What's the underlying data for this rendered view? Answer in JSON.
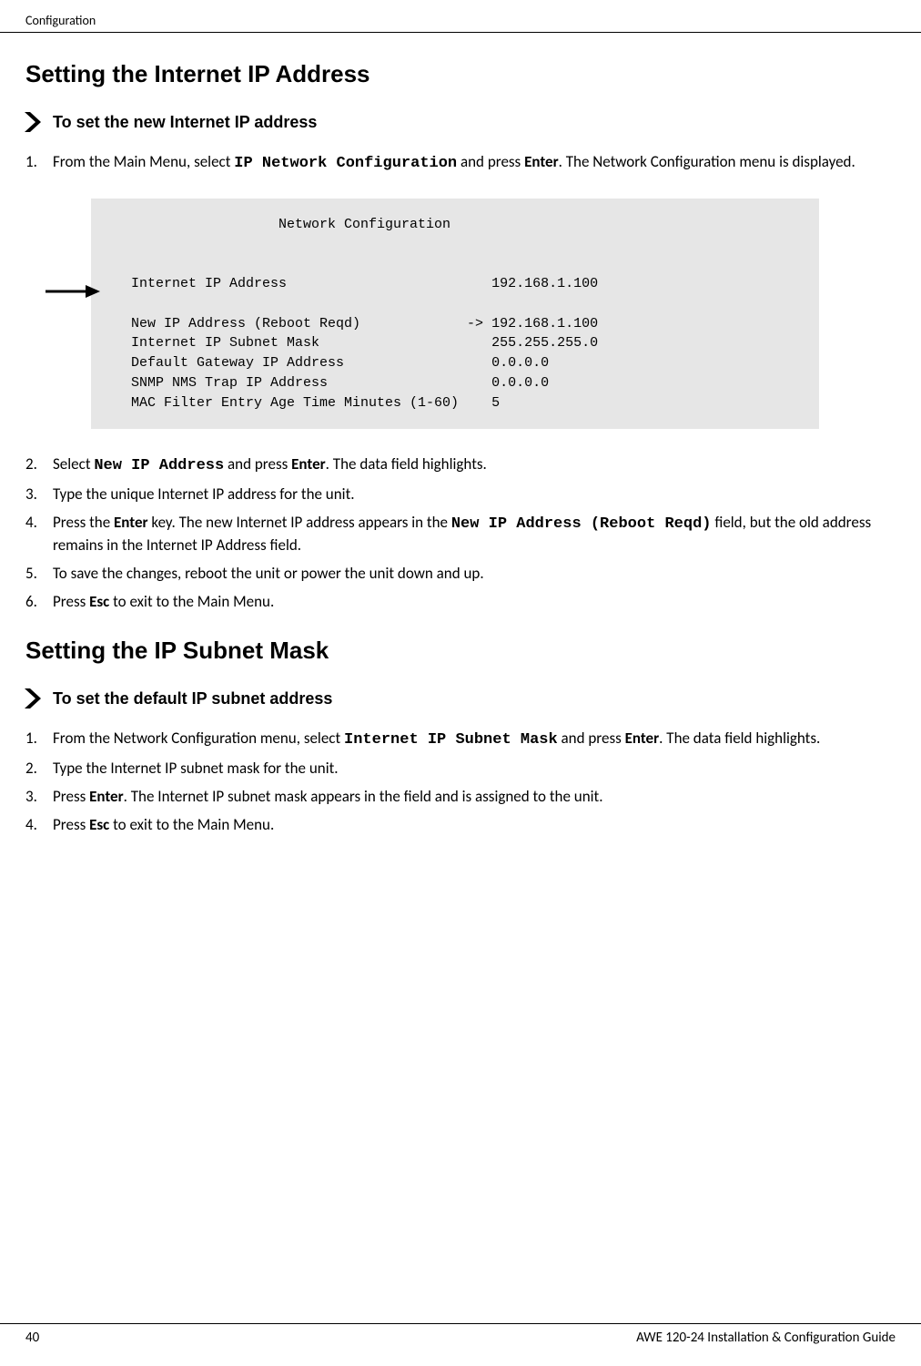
{
  "header": {
    "section": "Configuration"
  },
  "sections": {
    "h1_1": "Setting the Internet IP Address",
    "proc1_title": "To set the new Internet IP address",
    "h1_2": "Setting the IP Subnet Mask",
    "proc2_title": "To set the default IP subnet address"
  },
  "steps1": {
    "s1_num": "1.",
    "s1_a": "From the Main Menu, select ",
    "s1_b": "IP Network Configuration",
    "s1_c": " and press ",
    "s1_d": "Enter",
    "s1_e": ". The Network Configuration menu is displayed.",
    "s2_num": "2.",
    "s2_a": "Select ",
    "s2_b": "New IP Address",
    "s2_c": " and press ",
    "s2_d": "Enter",
    "s2_e": ". The data field highlights.",
    "s3_num": "3.",
    "s3_a": "Type the unique Internet IP address for the unit.",
    "s4_num": "4.",
    "s4_a": "Press the ",
    "s4_b": "Enter",
    "s4_c": " key. The new Internet IP address appears in the ",
    "s4_d": "New IP Address (Reboot Reqd)",
    "s4_e": " field, but the old address remains in the Internet IP Address field.",
    "s5_num": "5.",
    "s5_a": "To save the changes, reboot the unit or power the unit down and up.",
    "s6_num": "6.",
    "s6_a": "Press ",
    "s6_b": "Esc",
    "s6_c": " to exit to the Main Menu."
  },
  "code": {
    "title": "                  Network Configuration",
    "line1": "Internet IP Address                         192.168.1.100",
    "line2": "New IP Address (Reboot Reqd)             -> 192.168.1.100",
    "line3": "Internet IP Subnet Mask                     255.255.255.0",
    "line4": "Default Gateway IP Address                  0.0.0.0",
    "line5": "SNMP NMS Trap IP Address                    0.0.0.0",
    "line6": "MAC Filter Entry Age Time Minutes (1-60)    5"
  },
  "steps2": {
    "s1_num": "1.",
    "s1_a": "From the Network Configuration menu, select ",
    "s1_b": "Internet IP Subnet Mask",
    "s1_c": " and press ",
    "s1_d": "Enter",
    "s1_e": ". The data field highlights.",
    "s2_num": "2.",
    "s2_a": "Type the Internet IP subnet mask for the unit.",
    "s3_num": "3.",
    "s3_a": "Press ",
    "s3_b": "Enter",
    "s3_c": ". The Internet IP subnet mask appears in the field and is assigned to the unit.",
    "s4_num": "4.",
    "s4_a": "Press ",
    "s4_b": "Esc",
    "s4_c": " to exit to the Main Menu."
  },
  "footer": {
    "page": "40",
    "doc": "AWE 120-24 Installation & Configuration Guide"
  }
}
